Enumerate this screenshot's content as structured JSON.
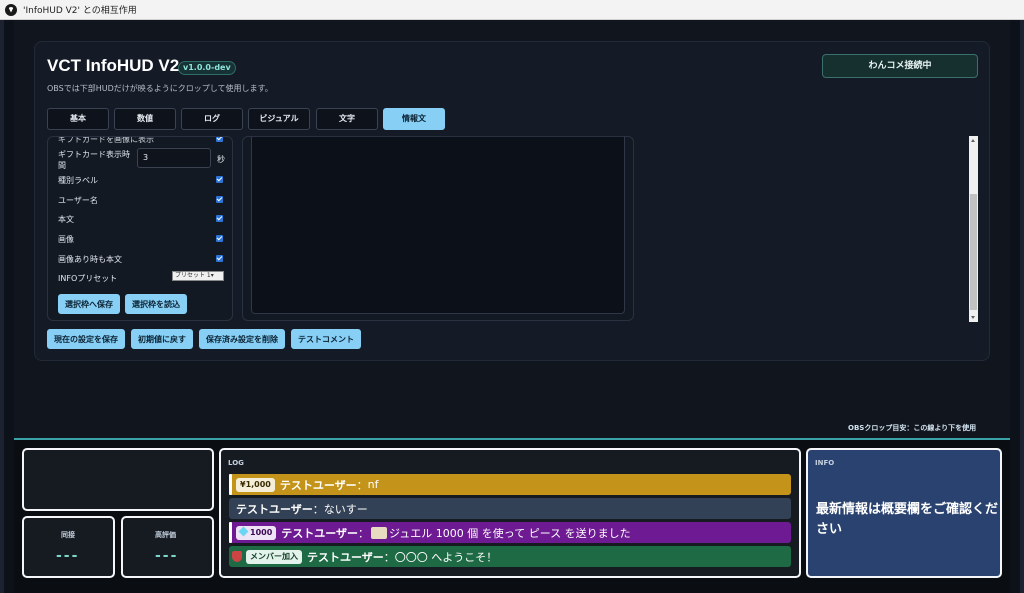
{
  "window": {
    "title": "'InfoHUD V2' との相互作用"
  },
  "header": {
    "app_title": "VCT InfoHUD V2",
    "version": "v1.0.0-dev",
    "subtitle": "OBSでは下部HUDだけが映るようにクロップして使用します。",
    "connect_button": "わんコメ接続中"
  },
  "tabs": [
    {
      "label": "基本"
    },
    {
      "label": "数値"
    },
    {
      "label": "ログ"
    },
    {
      "label": "ビジュアル"
    },
    {
      "label": "文字"
    },
    {
      "label": "情報文",
      "active": true
    }
  ],
  "settings": {
    "partial_row": "ギフトカードを画像に表示",
    "gift_time_label_1": "ギフトカード表示時",
    "gift_time_label_2": "間",
    "gift_time_value": "3",
    "gift_time_unit": "秒",
    "toggles": [
      {
        "label": "種別ラベル",
        "checked": true
      },
      {
        "label": "ユーザー名",
        "checked": true
      },
      {
        "label": "本文",
        "checked": true
      },
      {
        "label": "画像",
        "checked": true
      },
      {
        "label": "画像あり時も本文",
        "checked": true
      }
    ],
    "preset_label": "INFOプリセット",
    "preset_value": "プリセット 1",
    "save_selection": "選択枠へ保存",
    "load_selection": "選択枠を読込"
  },
  "actions": {
    "save_current": "現在の設定を保存",
    "reset_defaults": "初期値に戻す",
    "delete_saved": "保存済み設定を削除",
    "test_comment": "テストコメント"
  },
  "crop_note": "OBSクロップ目安：この線より下を使用",
  "hud": {
    "stat_left_label": "同接",
    "stat_left_value": "---",
    "stat_right_label": "高評価",
    "stat_right_value": "---",
    "log_title": "LOG",
    "log": [
      {
        "badge": "¥1,000",
        "user": "テストユーザー",
        "sep": "：",
        "text": "nf",
        "color": "#c39419"
      },
      {
        "user": "テストユーザー",
        "sep": "：",
        "text": "ないすー",
        "color": "#334156"
      },
      {
        "badge": "1000",
        "user": "テストユーザー",
        "sep": "：",
        "text": "ジュエル 1000 個 を使って ピース を送りました",
        "color": "#6d1a93"
      },
      {
        "badge": "メンバー加入",
        "user": "テストユーザー",
        "sep": "：",
        "text": "〇〇〇 へようこそ！",
        "color": "#1d6a45"
      }
    ],
    "info_title": "INFO",
    "info_text": "最新情報は概要欄をご確認ください"
  },
  "colors": {
    "accent": "#87cff5",
    "teal": "#3aa3a8",
    "superchat": "#c39419",
    "jewel": "#6d1a93",
    "member": "#1d6a45",
    "info_bg": "#2a4270"
  }
}
